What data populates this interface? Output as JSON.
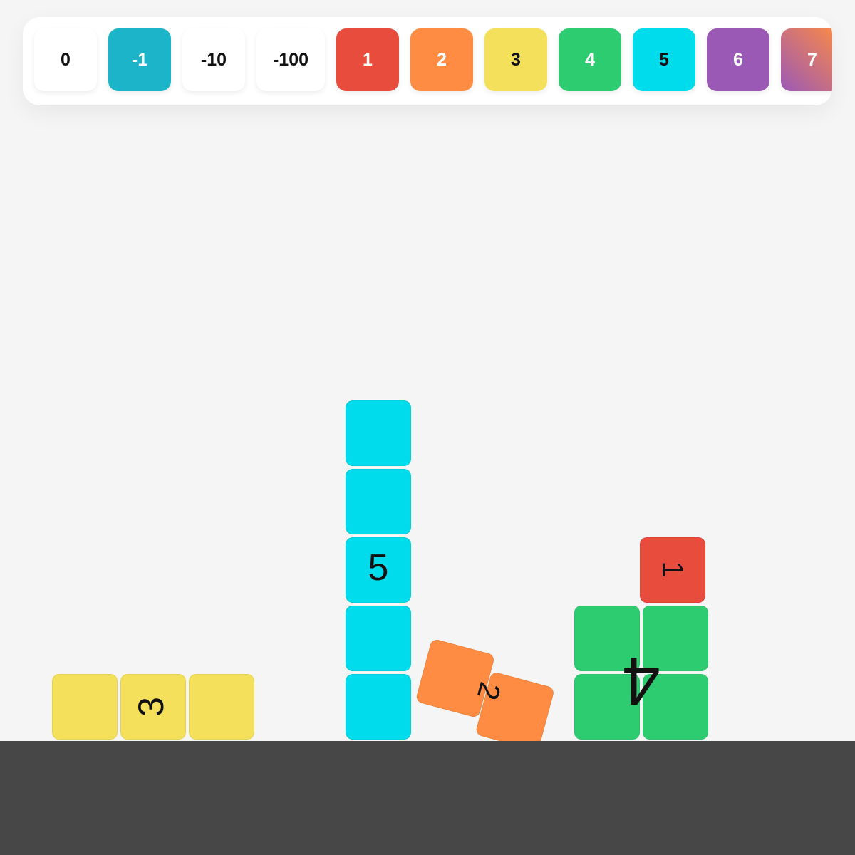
{
  "toolbar": {
    "buttons": [
      {
        "label": "0",
        "bg": "#ffffff",
        "fg": "#111111"
      },
      {
        "label": "-1",
        "bg": "#1bb4c8",
        "fg": "#ffffff"
      },
      {
        "label": "-10",
        "bg": "#ffffff",
        "fg": "#111111"
      },
      {
        "label": "-100",
        "bg": "#ffffff",
        "fg": "#111111"
      },
      {
        "label": "1",
        "bg": "#e74c3c",
        "fg": "#ffffff"
      },
      {
        "label": "2",
        "bg": "#ff8c42",
        "fg": "#ffffff"
      },
      {
        "label": "3",
        "bg": "#f5e05c",
        "fg": "#111111"
      },
      {
        "label": "4",
        "bg": "#2ecc71",
        "fg": "#ffffff"
      },
      {
        "label": "5",
        "bg": "#00dcec",
        "fg": "#111111"
      },
      {
        "label": "6",
        "bg": "#9b59b6",
        "fg": "#ffffff"
      },
      {
        "label": "7",
        "bg": "linear-gradient(45deg, #9b59b6, #ff8c42)",
        "fg": "#ffffff"
      }
    ]
  },
  "scene": {
    "colors": {
      "one": "#e74c3c",
      "two": "#ff8c42",
      "three": "#f5e05c",
      "four": "#2ecc71",
      "five": "#00dcec",
      "ground": "#474747"
    },
    "numberblocks": [
      {
        "label": "1",
        "color": "one"
      },
      {
        "label": "2",
        "color": "two"
      },
      {
        "label": "3",
        "color": "three"
      },
      {
        "label": "4",
        "color": "four"
      },
      {
        "label": "5",
        "color": "five"
      }
    ]
  }
}
